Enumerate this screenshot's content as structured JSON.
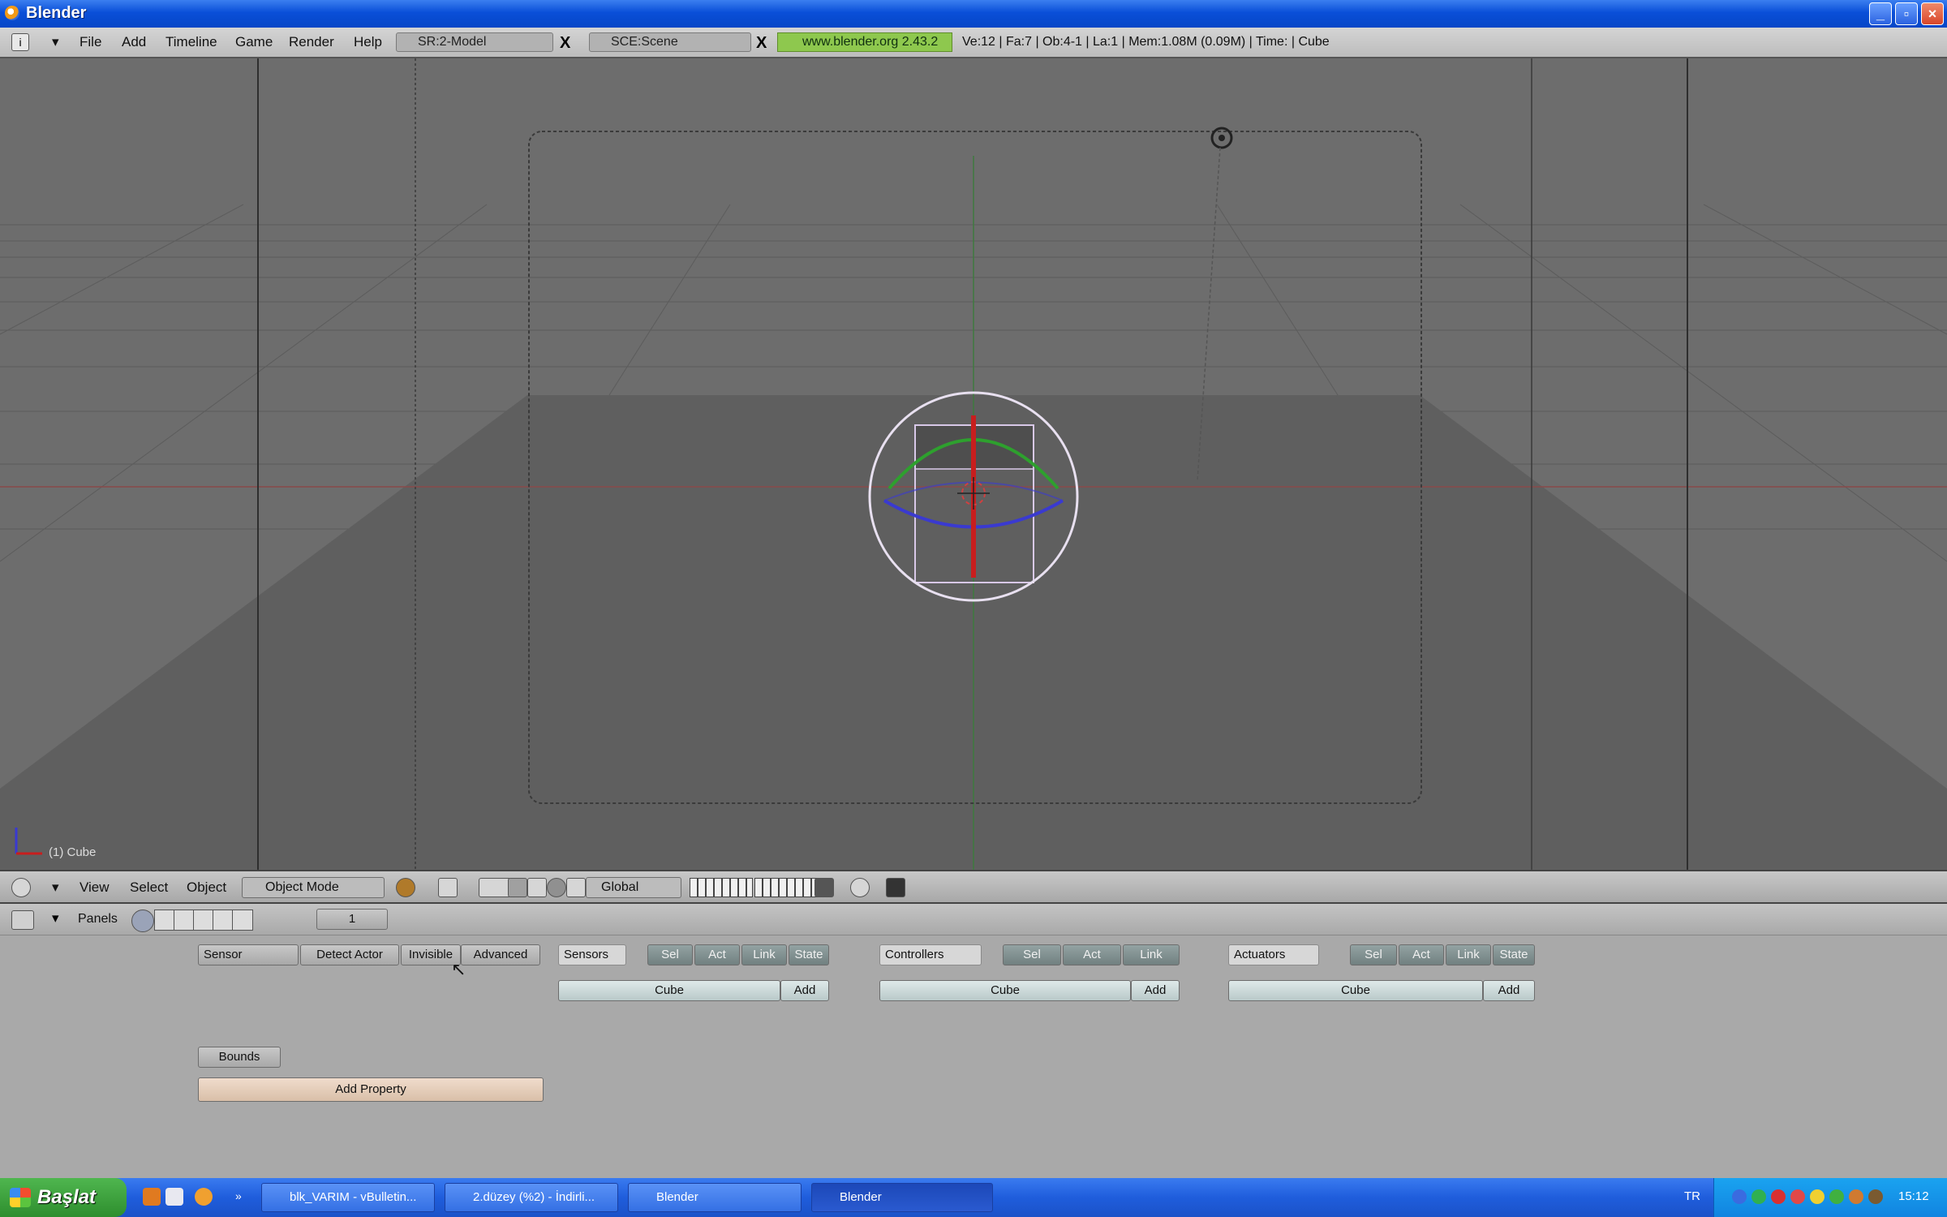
{
  "window": {
    "title": "Blender"
  },
  "info_header": {
    "menus": [
      "File",
      "Add",
      "Timeline",
      "Game",
      "Render",
      "Help"
    ],
    "screen_field": "SR:2-Model",
    "scene_field": "SCE:Scene",
    "url": "www.blender.org 2.43.2",
    "stats": "Ve:12 | Fa:7 | Ob:4-1 | La:1   | Mem:1.08M (0.09M)   | Time: | Cube"
  },
  "viewport": {
    "object_label": "(1) Cube"
  },
  "view_header": {
    "menus": [
      "View",
      "Select",
      "Object"
    ],
    "mode": "Object Mode",
    "orientation": "Global"
  },
  "panel_header": {
    "label": "Panels",
    "page_value": "1"
  },
  "logic": {
    "physics_type": "Sensor",
    "detect_actor": "Detect Actor",
    "invisible": "Invisible",
    "advanced": "Advanced",
    "bounds": "Bounds",
    "add_property": "Add Property",
    "sections": [
      {
        "name": "Sensors",
        "buttons": [
          "Sel",
          "Act",
          "Link",
          "State"
        ],
        "object": "Cube",
        "add": "Add"
      },
      {
        "name": "Controllers",
        "buttons": [
          "Sel",
          "Act",
          "Link"
        ],
        "object": "Cube",
        "add": "Add"
      },
      {
        "name": "Actuators",
        "buttons": [
          "Sel",
          "Act",
          "Link",
          "State"
        ],
        "object": "Cube",
        "add": "Add"
      }
    ]
  },
  "taskbar": {
    "start": "Başlat",
    "tasks": [
      "blk_VARIM - vBulletin...",
      "2.düzey (%2) - İndirli...",
      "Blender",
      "Blender"
    ],
    "tray_lang": "TR",
    "clock": "15:12"
  },
  "colors": {
    "xp_blue": "#0a4fd8",
    "blender_header": "#c8c8c8",
    "viewport_bg": "#6a6a6a",
    "url_green": "#8ec84e",
    "link_button": "#7a8a8a",
    "add_property": "#e6cfbb",
    "axis_red": "#c81e1e",
    "axis_green": "#2ea02e",
    "axis_blue": "#3a3ad0"
  }
}
